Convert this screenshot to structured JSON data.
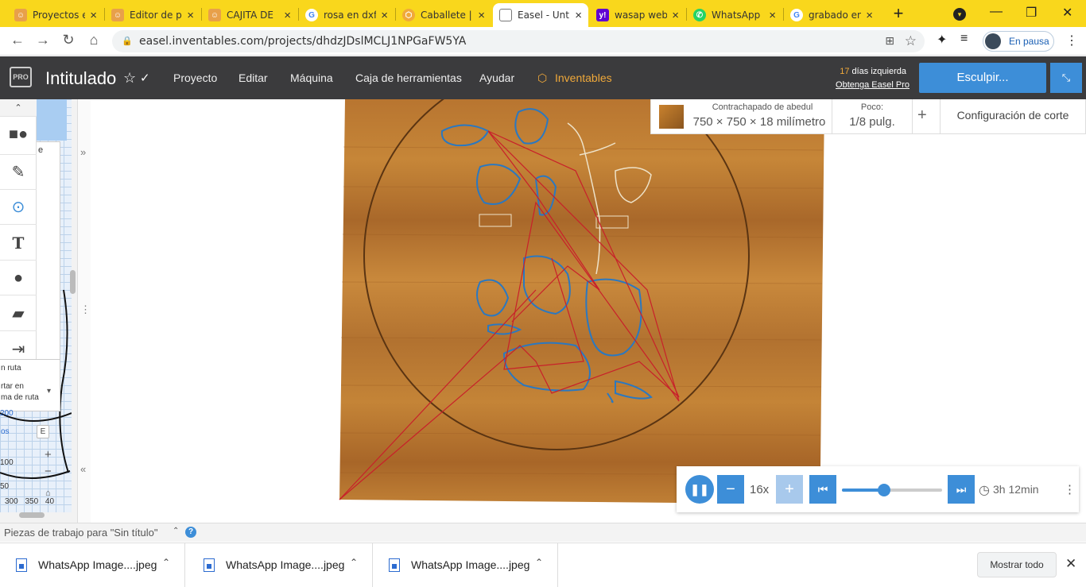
{
  "browser": {
    "tabs": [
      {
        "title": "Proyectos e",
        "favicon": "person-icon",
        "active": false
      },
      {
        "title": "Editor de p",
        "favicon": "person-icon",
        "active": false
      },
      {
        "title": "CAJITA DE",
        "favicon": "person-icon",
        "active": false
      },
      {
        "title": "rosa en dxf",
        "favicon": "google-icon",
        "active": false
      },
      {
        "title": "Caballete |",
        "favicon": "hexagon-icon",
        "active": false
      },
      {
        "title": "Easel - Unt",
        "favicon": "monitor-icon",
        "active": true
      },
      {
        "title": "wasap web",
        "favicon": "yahoo-icon",
        "active": false
      },
      {
        "title": "WhatsApp",
        "favicon": "whatsapp-icon",
        "active": false
      },
      {
        "title": "grabado en",
        "favicon": "google-icon",
        "active": false
      }
    ],
    "url": "easel.inventables.com/projects/dhdzJDslMCLJ1NPGaFW5YA",
    "profile_status": "En pausa"
  },
  "app": {
    "project_title": "Intitulado",
    "pro_badge": "PRO",
    "menus": [
      "Proyecto",
      "Editar",
      "Máquina",
      "Caja de herramientas",
      "Ayudar",
      "Inventables"
    ],
    "trial_days": "17",
    "trial_suffix": " días izquierda",
    "trial_link": "Obtenga Easel Pro",
    "carve_button": "Esculpir...",
    "fit_icon": "fit-to-screen-icon"
  },
  "toolbar": {
    "tools": [
      "shapes-icon",
      "pen-icon",
      "point-icon",
      "text-icon",
      "apple-icon",
      "lego-icon",
      "import-icon"
    ],
    "text_tool_glyph": "T"
  },
  "left_panel_fragments": {
    "frag1": "e",
    "frag2": "n ruta",
    "frag3a": "rtar en",
    "frag3b": "ma de ruta",
    "frag4": "os",
    "frag4_key": "E",
    "ruler_200": "200",
    "ruler_100": "100",
    "ruler_50": "50",
    "axis_labels": "300 350 40"
  },
  "material_bar": {
    "material_name": "Contrachapado de abedul",
    "dimensions": "750 × 750 × 18 milímetro",
    "bit_label": "Poco:",
    "bit_value": "1/8 pulg.",
    "add_label": "+",
    "cut_settings": "Configuración de corte"
  },
  "player": {
    "speed": "16x",
    "progress": 0.42,
    "time_left": "3h 12min"
  },
  "status": {
    "workpieces": "Piezas de trabajo para \"Sin título\""
  },
  "downloads": {
    "items": [
      "WhatsApp Image....jpeg",
      "WhatsApp Image....jpeg",
      "WhatsApp Image....jpeg"
    ],
    "show_all": "Mostrar todo"
  },
  "colors": {
    "accent": "#3d8ed8",
    "tabbar": "#f9d71c",
    "appbar": "#3b3b3d",
    "inventables_orange": "#f0a93a",
    "wood": "#b9772e",
    "rapid_path": "#c8202a",
    "cut_path": "#2b78c0"
  }
}
